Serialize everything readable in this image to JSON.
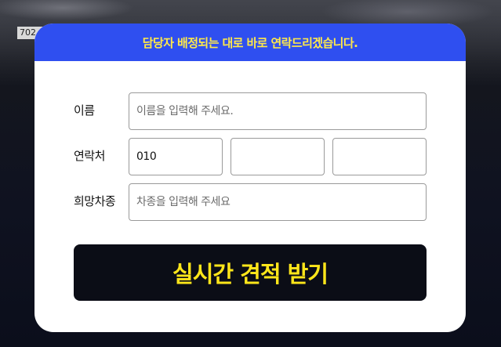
{
  "background": {
    "plate_text": "702"
  },
  "banner": {
    "text": "담당자 배정되는 대로 바로 연락드리겠습니다."
  },
  "form": {
    "name": {
      "label": "이름",
      "placeholder": "이름을 입력해 주세요."
    },
    "phone": {
      "label": "연락처",
      "part1_value": "010",
      "part2_value": "",
      "part3_value": ""
    },
    "car": {
      "label": "희망차종",
      "placeholder": "차종을 입력해 주세요"
    },
    "submit_label": "실시간 견적 받기"
  },
  "colors": {
    "banner_bg": "#2f4ff0",
    "banner_text": "#ffe94a",
    "button_bg": "#0b0d16",
    "button_text": "#ffe61a"
  }
}
